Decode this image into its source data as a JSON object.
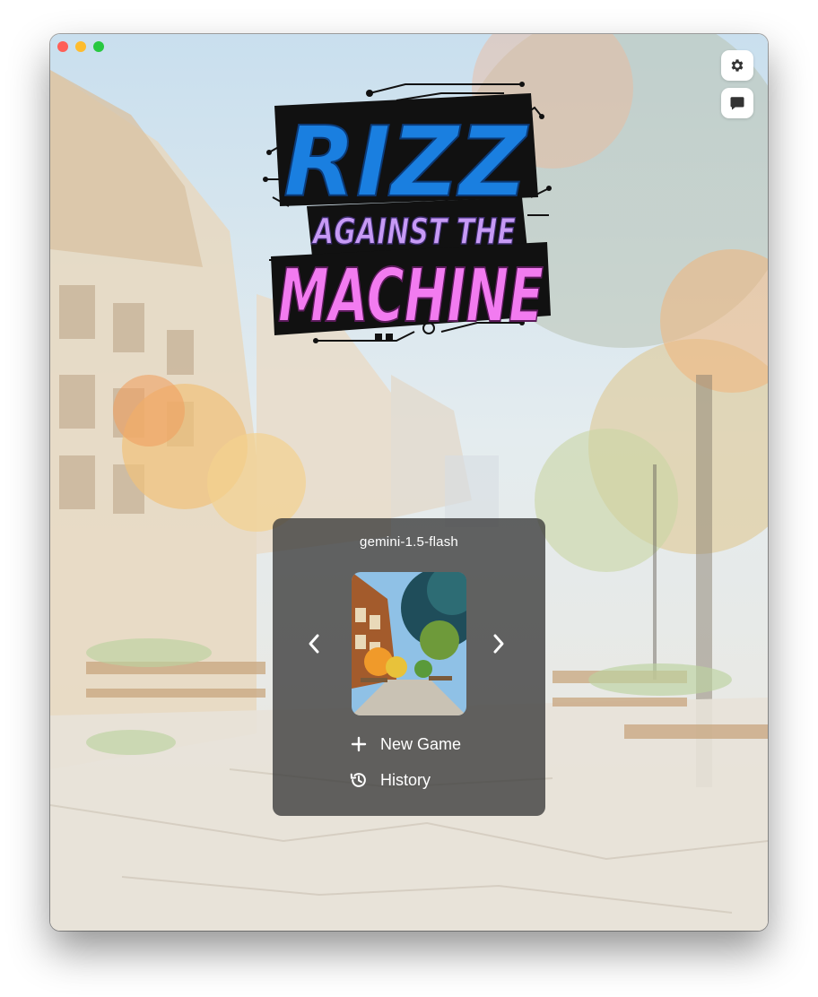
{
  "window": {
    "traffic_lights": [
      "close",
      "minimize",
      "zoom"
    ]
  },
  "toolbar": {
    "settings_icon": "gear-icon",
    "chat_icon": "chat-bubble-icon"
  },
  "logo": {
    "line1": "RIZZ",
    "line2": "AGAINST THE",
    "line3": "MACHINE"
  },
  "selector": {
    "model": "gemini-1.5-flash",
    "prev_icon": "chevron-left-icon",
    "next_icon": "chevron-right-icon"
  },
  "menu": {
    "new_game": "New Game",
    "history": "History"
  },
  "colors": {
    "logo_blue": "#1a7fe0",
    "logo_pink": "#f27bf0",
    "panel": "#3a3a3a"
  }
}
